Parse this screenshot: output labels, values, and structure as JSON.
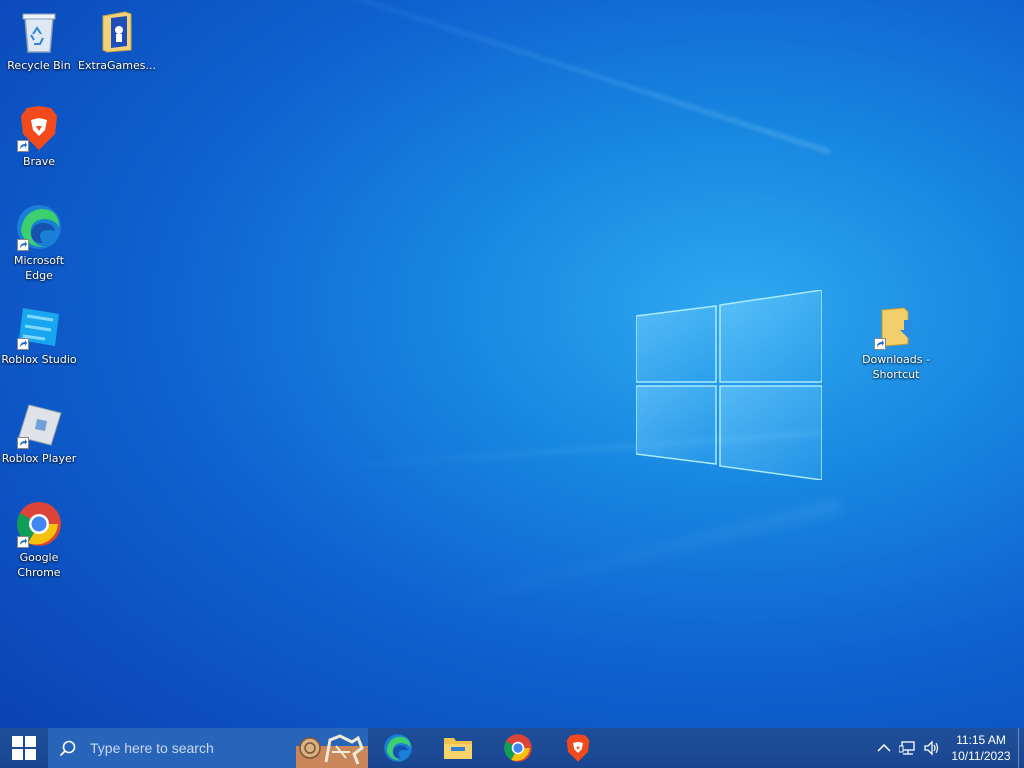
{
  "desktop": {
    "icons": [
      {
        "label": "Recycle Bin",
        "icon": "recycle-bin-icon"
      },
      {
        "label": "ExtraGames...",
        "icon": "folder-icon"
      },
      {
        "label": "Brave",
        "icon": "brave-icon"
      },
      {
        "label": "Microsoft Edge",
        "icon": "edge-icon"
      },
      {
        "label": "Roblox Studio",
        "icon": "roblox-studio-icon"
      },
      {
        "label": "Roblox Player",
        "icon": "roblox-player-icon"
      },
      {
        "label": "Google Chrome",
        "icon": "chrome-icon"
      },
      {
        "label": "Downloads - Shortcut",
        "icon": "downloads-folder-icon"
      }
    ]
  },
  "taskbar": {
    "search_placeholder": "Type here to search",
    "pinned_apps": [
      "Microsoft Edge",
      "File Explorer",
      "Google Chrome",
      "Brave"
    ],
    "clock": {
      "time": "11:15 AM",
      "date": "10/11/2023"
    }
  },
  "colors": {
    "taskbar": "#1a4690",
    "search_box": "#2864b8",
    "wallpaper_accent": "#1786e0"
  }
}
